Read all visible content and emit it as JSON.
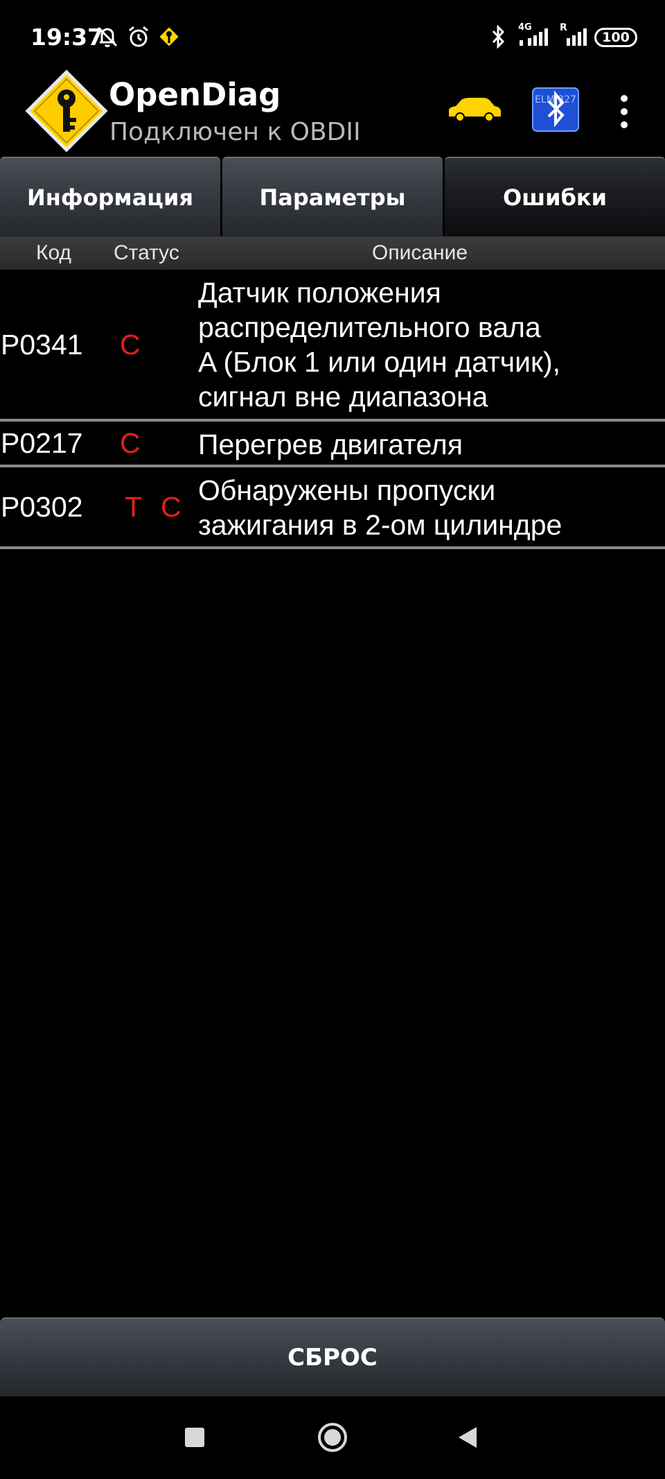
{
  "status_bar": {
    "time": "19:37",
    "battery": "100",
    "icons": [
      "notifications-off-icon",
      "alarm-icon",
      "opendiag-notification-icon",
      "bluetooth-icon",
      "signal-4g-icon",
      "signal-roaming-icon",
      "battery-icon"
    ],
    "net_label_1": "4G",
    "net_label_2": "R"
  },
  "app": {
    "title": "OpenDiag",
    "subtitle": "Подключен к OBDII",
    "logo_icon": "key-warning-sign-icon",
    "car_icon": "car-icon",
    "bt_icon": "bluetooth-elm327-icon",
    "menu_icon": "more-vert-icon",
    "bt_badge": "ELM 327",
    "accent_color": "#ffd400"
  },
  "tabs": [
    {
      "label": "Информация",
      "active": false
    },
    {
      "label": "Параметры",
      "active": false
    },
    {
      "label": "Ошибки",
      "active": true
    }
  ],
  "columns": {
    "code": "Код",
    "status": "Статус",
    "description": "Описание"
  },
  "errors": [
    {
      "code": "P0341",
      "status_t": "",
      "status_c": "C",
      "description_lines": [
        "Датчик положения",
        "распределительного вала",
        "A (Блок 1 или один датчик),",
        "сигнал вне диапазона"
      ]
    },
    {
      "code": "P0217",
      "status_t": "",
      "status_c": "C",
      "description_lines": [
        "Перегрев двигателя"
      ]
    },
    {
      "code": "P0302",
      "status_t": "T",
      "status_c": "C",
      "description_lines": [
        "Обнаружены пропуски",
        "зажигания в 2-ом цилиндре"
      ]
    }
  ],
  "reset_button": {
    "label": "СБРОС"
  },
  "nav": {
    "recents_icon": "square-recents-icon",
    "home_icon": "circle-home-icon",
    "back_icon": "triangle-back-icon"
  },
  "colors": {
    "status_red": "#e0201a",
    "divider": "#8a8a8a"
  }
}
